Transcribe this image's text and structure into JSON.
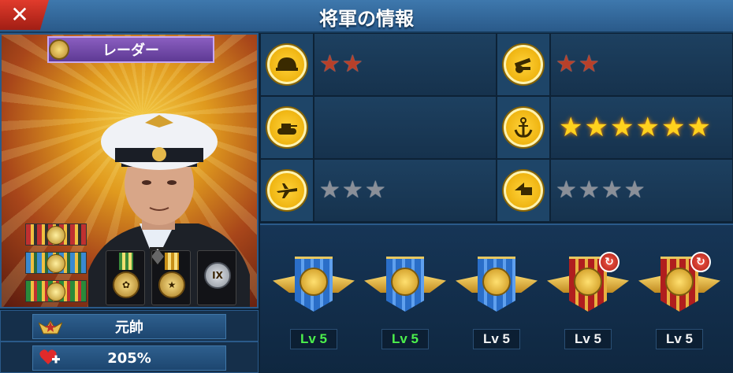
{
  "header": {
    "title": "将軍の情報",
    "close_icon": "close-icon"
  },
  "general": {
    "name": "レーダー",
    "rank": "元帥",
    "stat_value": "205%",
    "medal_text": "IX"
  },
  "categories": [
    {
      "icon": "infantry-helmet-icon",
      "stars": 2,
      "star_color": "red"
    },
    {
      "icon": "artillery-cannon-icon",
      "stars": 2,
      "star_color": "red"
    },
    {
      "icon": "tank-icon",
      "stars": 0,
      "star_color": "none"
    },
    {
      "icon": "navy-anchor-icon",
      "stars": 6,
      "star_color": "gold"
    },
    {
      "icon": "airforce-plane-icon",
      "stars": 3,
      "star_color": "gray"
    },
    {
      "icon": "missile-icon",
      "stars": 4,
      "star_color": "gray"
    }
  ],
  "skills": [
    {
      "icon": "navy-ship-skill-icon",
      "level": "Lv 5",
      "style": "blue",
      "level_color": "green",
      "refresh": false
    },
    {
      "icon": "submarine-skill-icon",
      "level": "Lv 5",
      "style": "blue",
      "level_color": "green",
      "refresh": false
    },
    {
      "icon": "target-skill-icon",
      "level": "Lv 5",
      "style": "blue",
      "level_color": "white",
      "refresh": false
    },
    {
      "icon": "command-skill-icon",
      "level": "Lv 5",
      "style": "red",
      "level_color": "white",
      "refresh": true
    },
    {
      "icon": "eagle-skill-icon",
      "level": "Lv 5",
      "style": "red",
      "level_color": "white",
      "refresh": true
    }
  ],
  "colors": {
    "accent": "#2a5a8a",
    "gold": "#ffd21e",
    "green": "#4cf04c"
  }
}
